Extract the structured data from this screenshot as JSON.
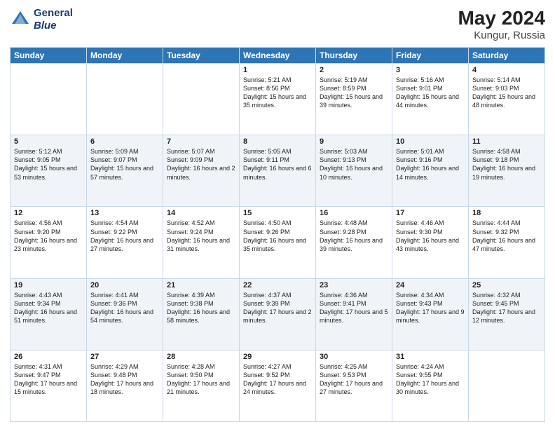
{
  "header": {
    "logo_line1": "General",
    "logo_line2": "Blue",
    "main_title": "May 2024",
    "subtitle": "Kungur, Russia"
  },
  "days_of_week": [
    "Sunday",
    "Monday",
    "Tuesday",
    "Wednesday",
    "Thursday",
    "Friday",
    "Saturday"
  ],
  "weeks": [
    [
      {
        "day": "",
        "info": ""
      },
      {
        "day": "",
        "info": ""
      },
      {
        "day": "",
        "info": ""
      },
      {
        "day": "1",
        "info": "Sunrise: 5:21 AM\nSunset: 8:56 PM\nDaylight: 15 hours and 35 minutes."
      },
      {
        "day": "2",
        "info": "Sunrise: 5:19 AM\nSunset: 8:59 PM\nDaylight: 15 hours and 39 minutes."
      },
      {
        "day": "3",
        "info": "Sunrise: 5:16 AM\nSunset: 9:01 PM\nDaylight: 15 hours and 44 minutes."
      },
      {
        "day": "4",
        "info": "Sunrise: 5:14 AM\nSunset: 9:03 PM\nDaylight: 15 hours and 48 minutes."
      }
    ],
    [
      {
        "day": "5",
        "info": "Sunrise: 5:12 AM\nSunset: 9:05 PM\nDaylight: 15 hours and 53 minutes."
      },
      {
        "day": "6",
        "info": "Sunrise: 5:09 AM\nSunset: 9:07 PM\nDaylight: 15 hours and 57 minutes."
      },
      {
        "day": "7",
        "info": "Sunrise: 5:07 AM\nSunset: 9:09 PM\nDaylight: 16 hours and 2 minutes."
      },
      {
        "day": "8",
        "info": "Sunrise: 5:05 AM\nSunset: 9:11 PM\nDaylight: 16 hours and 6 minutes."
      },
      {
        "day": "9",
        "info": "Sunrise: 5:03 AM\nSunset: 9:13 PM\nDaylight: 16 hours and 10 minutes."
      },
      {
        "day": "10",
        "info": "Sunrise: 5:01 AM\nSunset: 9:16 PM\nDaylight: 16 hours and 14 minutes."
      },
      {
        "day": "11",
        "info": "Sunrise: 4:58 AM\nSunset: 9:18 PM\nDaylight: 16 hours and 19 minutes."
      }
    ],
    [
      {
        "day": "12",
        "info": "Sunrise: 4:56 AM\nSunset: 9:20 PM\nDaylight: 16 hours and 23 minutes."
      },
      {
        "day": "13",
        "info": "Sunrise: 4:54 AM\nSunset: 9:22 PM\nDaylight: 16 hours and 27 minutes."
      },
      {
        "day": "14",
        "info": "Sunrise: 4:52 AM\nSunset: 9:24 PM\nDaylight: 16 hours and 31 minutes."
      },
      {
        "day": "15",
        "info": "Sunrise: 4:50 AM\nSunset: 9:26 PM\nDaylight: 16 hours and 35 minutes."
      },
      {
        "day": "16",
        "info": "Sunrise: 4:48 AM\nSunset: 9:28 PM\nDaylight: 16 hours and 39 minutes."
      },
      {
        "day": "17",
        "info": "Sunrise: 4:46 AM\nSunset: 9:30 PM\nDaylight: 16 hours and 43 minutes."
      },
      {
        "day": "18",
        "info": "Sunrise: 4:44 AM\nSunset: 9:32 PM\nDaylight: 16 hours and 47 minutes."
      }
    ],
    [
      {
        "day": "19",
        "info": "Sunrise: 4:43 AM\nSunset: 9:34 PM\nDaylight: 16 hours and 51 minutes."
      },
      {
        "day": "20",
        "info": "Sunrise: 4:41 AM\nSunset: 9:36 PM\nDaylight: 16 hours and 54 minutes."
      },
      {
        "day": "21",
        "info": "Sunrise: 4:39 AM\nSunset: 9:38 PM\nDaylight: 16 hours and 58 minutes."
      },
      {
        "day": "22",
        "info": "Sunrise: 4:37 AM\nSunset: 9:39 PM\nDaylight: 17 hours and 2 minutes."
      },
      {
        "day": "23",
        "info": "Sunrise: 4:36 AM\nSunset: 9:41 PM\nDaylight: 17 hours and 5 minutes."
      },
      {
        "day": "24",
        "info": "Sunrise: 4:34 AM\nSunset: 9:43 PM\nDaylight: 17 hours and 9 minutes."
      },
      {
        "day": "25",
        "info": "Sunrise: 4:32 AM\nSunset: 9:45 PM\nDaylight: 17 hours and 12 minutes."
      }
    ],
    [
      {
        "day": "26",
        "info": "Sunrise: 4:31 AM\nSunset: 9:47 PM\nDaylight: 17 hours and 15 minutes."
      },
      {
        "day": "27",
        "info": "Sunrise: 4:29 AM\nSunset: 9:48 PM\nDaylight: 17 hours and 18 minutes."
      },
      {
        "day": "28",
        "info": "Sunrise: 4:28 AM\nSunset: 9:50 PM\nDaylight: 17 hours and 21 minutes."
      },
      {
        "day": "29",
        "info": "Sunrise: 4:27 AM\nSunset: 9:52 PM\nDaylight: 17 hours and 24 minutes."
      },
      {
        "day": "30",
        "info": "Sunrise: 4:25 AM\nSunset: 9:53 PM\nDaylight: 17 hours and 27 minutes."
      },
      {
        "day": "31",
        "info": "Sunrise: 4:24 AM\nSunset: 9:55 PM\nDaylight: 17 hours and 30 minutes."
      },
      {
        "day": "",
        "info": ""
      }
    ]
  ]
}
